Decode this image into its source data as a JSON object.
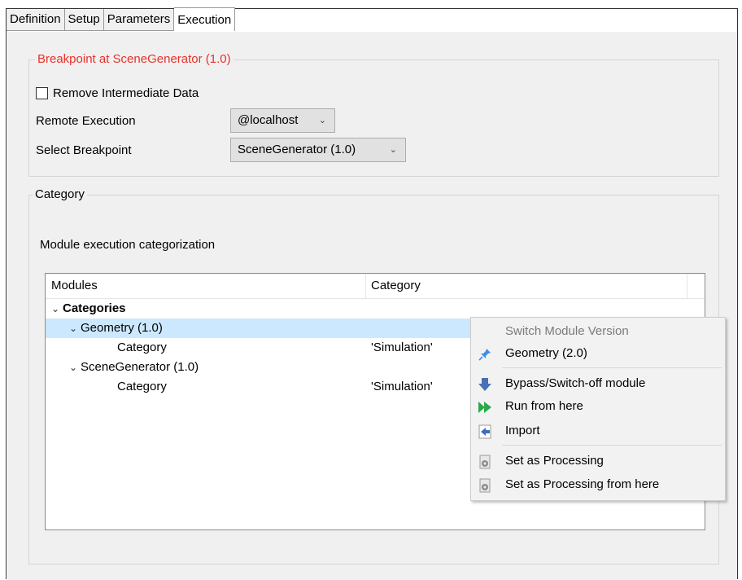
{
  "tabs": [
    {
      "label": "Definition"
    },
    {
      "label": "Setup"
    },
    {
      "label": "Parameters"
    },
    {
      "label": "Execution"
    }
  ],
  "breakpoint_group": {
    "title": "Breakpoint at SceneGenerator (1.0)",
    "title_color": "#e8302a",
    "remove_intermediate_label": "Remove Intermediate Data",
    "remove_intermediate_checked": false,
    "remote_execution_label": "Remote Execution",
    "remote_execution_value": "@localhost",
    "select_breakpoint_label": "Select Breakpoint",
    "select_breakpoint_value": "SceneGenerator (1.0)"
  },
  "category_group": {
    "title": "Category",
    "subtitle": "Module execution categorization",
    "columns": [
      "Modules",
      "Category"
    ],
    "rows": [
      {
        "module": "Categories",
        "category": ""
      },
      {
        "module": "Geometry (1.0)",
        "category": ""
      },
      {
        "module": "Category",
        "category": "'Simulation'"
      },
      {
        "module": "SceneGenerator (1.0)",
        "category": ""
      },
      {
        "module": "Category",
        "category": "'Simulation'"
      }
    ]
  },
  "context_menu": {
    "header": "Switch Module Version",
    "items": [
      {
        "label": "Geometry (2.0)",
        "icon": "pin-icon"
      },
      {
        "label": "Bypass/Switch-off module",
        "icon": "down-arrow-icon"
      },
      {
        "label": "Run from here",
        "icon": "fast-forward-icon"
      },
      {
        "label": "Import",
        "icon": "import-icon"
      },
      {
        "label": "Set as Processing",
        "icon": "processing-icon"
      },
      {
        "label": "Set as Processing from here",
        "icon": "processing-icon"
      }
    ]
  },
  "colors": {
    "selection": "#cce8ff",
    "accent_red": "#e8302a",
    "panel_bg": "#f0f0f0"
  }
}
